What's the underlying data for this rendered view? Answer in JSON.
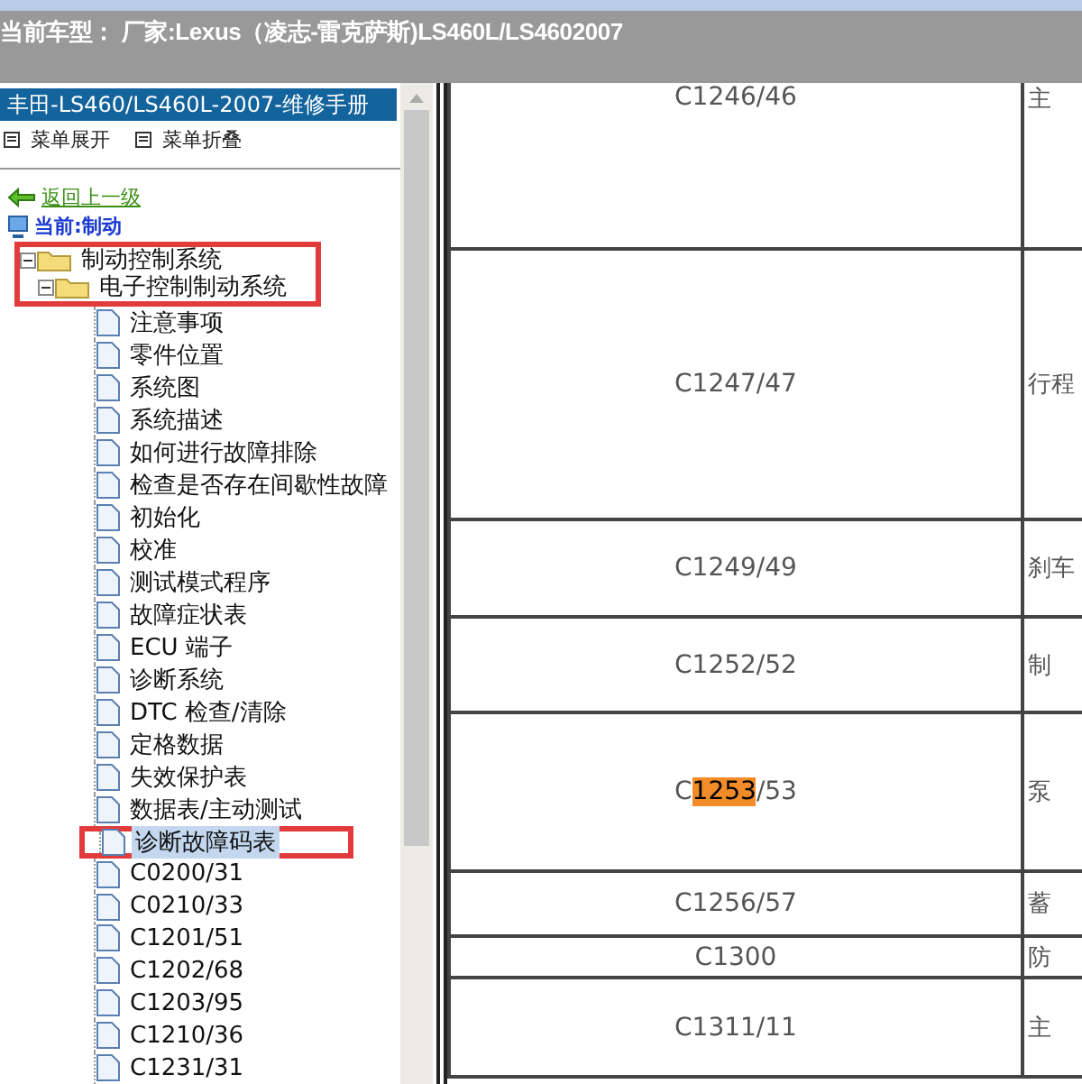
{
  "header": {
    "text": "当前车型： 厂家:Lexus（凌志-雷克萨斯)LS460L/LS4602007"
  },
  "sidebar": {
    "title": "丰田-LS460/LS460L-2007-维修手册",
    "menu_buttons": [
      "菜单展开",
      "菜单折叠"
    ],
    "back_link": "返回上一级",
    "current": "当前:制动",
    "tree": [
      {
        "label": "制动控制系统",
        "expanded": true,
        "outlined": true,
        "children": [
          {
            "label": "电子控制制动系统",
            "expanded": true,
            "outlined": true,
            "children": [
              {
                "label": "注意事项",
                "selected": false,
                "outlined": false
              },
              {
                "label": "零件位置",
                "selected": false,
                "outlined": false
              },
              {
                "label": "系统图",
                "selected": false,
                "outlined": false
              },
              {
                "label": "系统描述",
                "selected": false,
                "outlined": false
              },
              {
                "label": "如何进行故障排除",
                "selected": false,
                "outlined": false
              },
              {
                "label": "检查是否存在间歇性故障",
                "selected": false,
                "outlined": false
              },
              {
                "label": "初始化",
                "selected": false,
                "outlined": false
              },
              {
                "label": "校准",
                "selected": false,
                "outlined": false
              },
              {
                "label": "测试模式程序",
                "selected": false,
                "outlined": false
              },
              {
                "label": "故障症状表",
                "selected": false,
                "outlined": false
              },
              {
                "label": "ECU 端子",
                "selected": false,
                "outlined": false
              },
              {
                "label": "诊断系统",
                "selected": false,
                "outlined": false
              },
              {
                "label": "DTC 检查/清除",
                "selected": false,
                "outlined": false
              },
              {
                "label": "定格数据",
                "selected": false,
                "outlined": false
              },
              {
                "label": "失效保护表",
                "selected": false,
                "outlined": false
              },
              {
                "label": "数据表/主动测试",
                "selected": false,
                "outlined": false
              },
              {
                "label": "诊断故障码表",
                "selected": true,
                "outlined": true
              },
              {
                "label": "C0200/31",
                "selected": false,
                "outlined": false
              },
              {
                "label": "C0210/33",
                "selected": false,
                "outlined": false
              },
              {
                "label": "C1201/51",
                "selected": false,
                "outlined": false
              },
              {
                "label": "C1202/68",
                "selected": false,
                "outlined": false
              },
              {
                "label": "C1203/95",
                "selected": false,
                "outlined": false
              },
              {
                "label": "C1210/36",
                "selected": false,
                "outlined": false
              },
              {
                "label": "C1231/31",
                "selected": false,
                "outlined": false
              }
            ]
          }
        ]
      }
    ]
  },
  "table": {
    "rows": [
      {
        "code": [
          {
            "text": "C1246/46",
            "highlighted": false
          }
        ],
        "column_2": "主"
      },
      {
        "code": [
          {
            "text": "C1247/47",
            "highlighted": false
          }
        ],
        "column_2": "行程"
      },
      {
        "code": [
          {
            "text": "C1249/49",
            "highlighted": false
          }
        ],
        "column_2": "刹车"
      },
      {
        "code": [
          {
            "text": "C1252/52",
            "highlighted": false
          }
        ],
        "column_2": "制"
      },
      {
        "code": [
          {
            "text": "C",
            "highlighted": false
          },
          {
            "text": "1253",
            "highlighted": true
          },
          {
            "text": "/53",
            "highlighted": false
          }
        ],
        "column_2": "泵"
      },
      {
        "code": [
          {
            "text": "C1256/57",
            "highlighted": false
          }
        ],
        "column_2": "蓄"
      },
      {
        "code": [
          {
            "text": "C1300",
            "highlighted": false
          }
        ],
        "column_2": "防"
      },
      {
        "code": [
          {
            "text": "C1311/11",
            "highlighted": false
          }
        ],
        "column_2": "主"
      }
    ]
  }
}
